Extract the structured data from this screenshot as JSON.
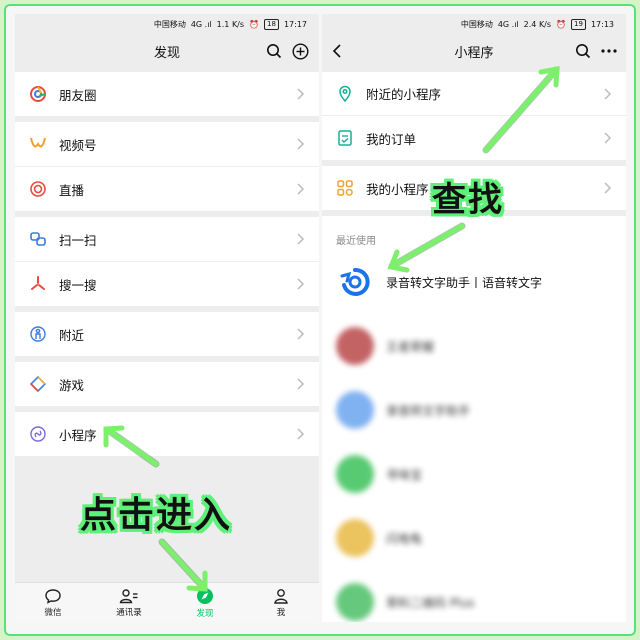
{
  "left": {
    "status": {
      "carrier": "中国移动",
      "signal": "4G .ıl",
      "speed": "1.1 K/s",
      "battery": "18",
      "time": "17:17"
    },
    "title": "发现",
    "items": [
      {
        "label": "朋友圈",
        "icon": "moments-icon"
      },
      {
        "label": "视频号",
        "icon": "channels-icon"
      },
      {
        "label": "直播",
        "icon": "live-icon"
      },
      {
        "label": "扫一扫",
        "icon": "scan-icon"
      },
      {
        "label": "搜一搜",
        "icon": "search-sparkle-icon"
      },
      {
        "label": "附近",
        "icon": "nearby-icon"
      },
      {
        "label": "游戏",
        "icon": "games-icon"
      },
      {
        "label": "小程序",
        "icon": "mini-program-icon"
      }
    ],
    "tabs": [
      {
        "label": "微信",
        "icon": "chat-icon"
      },
      {
        "label": "通讯录",
        "icon": "contacts-icon"
      },
      {
        "label": "发现",
        "icon": "discover-icon",
        "active": true
      },
      {
        "label": "我",
        "icon": "me-icon"
      }
    ]
  },
  "right": {
    "status": {
      "carrier": "中国移动",
      "signal": "4G .ıl",
      "speed": "2.4 K/s",
      "battery": "19",
      "time": "17:13"
    },
    "title": "小程序",
    "items": [
      {
        "label": "附近的小程序",
        "icon": "location-icon"
      },
      {
        "label": "我的订单",
        "icon": "order-icon"
      },
      {
        "label": "我的小程序",
        "icon": "my-mini-programs-icon"
      }
    ],
    "recent_label": "最近使用",
    "recent": [
      {
        "name": "录音转文字助手丨语音转文字",
        "color": "#1a73e8"
      },
      {
        "name": "王者荣耀",
        "color": "#b9484a"
      },
      {
        "name": "录音转文字助手",
        "color": "#6aa5ef"
      },
      {
        "name": "寻味宝",
        "color": "#3cc15a"
      },
      {
        "name": "闪电龟",
        "color": "#e8b944"
      },
      {
        "name": "草料二维码 Plus",
        "color": "#4cbf66"
      }
    ]
  },
  "annotations": {
    "enter": "点击进入",
    "find": "查找"
  },
  "colors": {
    "accent": "#07c160",
    "highlight": "#5ff07a",
    "arrow": "#7cf06a"
  }
}
